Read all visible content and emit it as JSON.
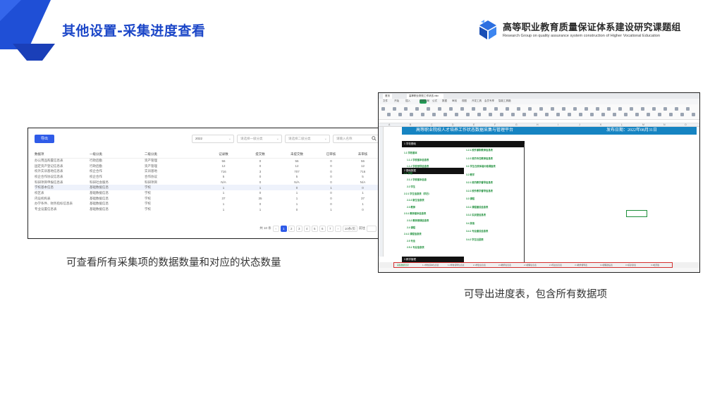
{
  "header": {
    "title": "其他设置-采集进度查看",
    "brand_cn": "高等职业教育质量保证体系建设研究课题组",
    "brand_en": "Research Group on quality assurance system construction of Higher Vocational Education",
    "brand_color": "#1c47c8"
  },
  "left_shot": {
    "export_button": "导出",
    "filters": {
      "year": "2022",
      "category_placeholder": "请选择一级分类",
      "subcategory_placeholder": "请选择二级分类",
      "search_placeholder": "请输入名称"
    },
    "columns": [
      "数据项",
      "一级分类",
      "二级分类",
      "记录数",
      "提交数",
      "未提交数",
      "已审核",
      "未审核"
    ],
    "rows": [
      [
        "办公用品购置信息表",
        "行政后勤",
        "资产管理",
        "56",
        "0",
        "56",
        "0",
        "56"
      ],
      [
        "固定资产登记信息表",
        "行政后勤",
        "资产管理",
        "12",
        "0",
        "12",
        "0",
        "12"
      ],
      [
        "校外实训基地信息表",
        "校企合作",
        "实训基地",
        "716",
        "3",
        "707",
        "0",
        "716"
      ],
      [
        "校企合作协议信息表",
        "校企合作",
        "合作协议",
        "5",
        "0",
        "5",
        "0",
        "5"
      ],
      [
        "科研项目申报信息表",
        "科研社会服务",
        "科研项目",
        "N/A",
        "0",
        "N/A",
        "0",
        "N/A"
      ],
      [
        "学校基本信息",
        "基础数据信息",
        "学校",
        "1",
        "1",
        "0",
        "1",
        "0"
      ],
      [
        "校区表",
        "基础数据信息",
        "学校",
        "1",
        "0",
        "1",
        "0",
        "1"
      ],
      [
        "内设机构表",
        "基础数据信息",
        "学校",
        "37",
        "35",
        "1",
        "0",
        "37"
      ],
      [
        "办学条件、财务指标信息表",
        "基础数据信息",
        "学校",
        "1",
        "0",
        "1",
        "0",
        "1"
      ],
      [
        "专业设置信息表",
        "基础数据信息",
        "学校",
        "1",
        "1",
        "0",
        "1",
        "0"
      ]
    ],
    "highlighted_row": 5,
    "pager": {
      "total": "共 10 条",
      "pages": [
        "1",
        "2",
        "3",
        "4",
        "5",
        "6",
        "7"
      ],
      "active_page": "1",
      "page_size": "10条/页",
      "goto_label": "前往"
    }
  },
  "captions": {
    "left": "可查看所有采集项的数据数量和对应的状态数量",
    "right": "可导出进度表，包含所有数据项"
  },
  "right_shot": {
    "browser_tabs": [
      "首页",
      "高等职业院校工作状态.xlsx"
    ],
    "menu": [
      "文件",
      "开始",
      "插入",
      "页面布局",
      "公式",
      "数据",
      "审阅",
      "视图",
      "开发工具",
      "会员专享",
      "智能工具箱"
    ],
    "banner_title": "高等职业院校人才培养工作状态数据采集与管理平台",
    "banner_date": "发布日期：2022年08月31日",
    "columns": [
      "A",
      "B",
      "C",
      "D",
      "E",
      "F",
      "G",
      "H",
      "I",
      "J",
      "K",
      "L",
      "M",
      "N",
      "O"
    ],
    "section_headers": [
      "1 学校基础",
      "2 基础数据",
      "3 教学管理"
    ],
    "items_left": [
      "1.1 学校基本",
      "1.1.1 学校基本信息表",
      "1.1.2 学校领导信息表",
      "2.1 学校",
      "2.1.1 学校基本信息",
      "2.2 学生",
      "2.2.1 学生信息表（学历）",
      "2.2.2 新生信息表",
      "2.3 教师",
      "2.3.1 教师基本信息表",
      "2.3.2 教师授课信息表",
      "2.4 课程",
      "2.4.1 课程信息表",
      "2.5 专业",
      "2.5.1 专业信息表"
    ],
    "items_right": [
      "1.2.1 校外兼职教师信息表",
      "1.2.2 校内专任教师信息表",
      "3.1 学生在校体验问卷调查表",
      "3.2 教学",
      "3.2.1 校内教学督导信息表",
      "3.2.2 校外教学督导信息表",
      "3.3 课程",
      "3.3.1 课程建设信息表",
      "3.3.2 实训室信息表",
      "3.4 其他",
      "3.4.1 专业建设信息表",
      "3.4.2 学生社团表"
    ],
    "sheet_tabs": [
      "采集数据目录",
      "1.1学校基本信息表",
      "1.2学校领导信息表",
      "2.1学生信息表",
      "2.2教师信息表",
      "2.3课程信息表",
      "2.4专业信息表",
      "3.1教学督导表",
      "3.2课程建设表",
      "3.3实训室表",
      "3.4社团表"
    ]
  }
}
